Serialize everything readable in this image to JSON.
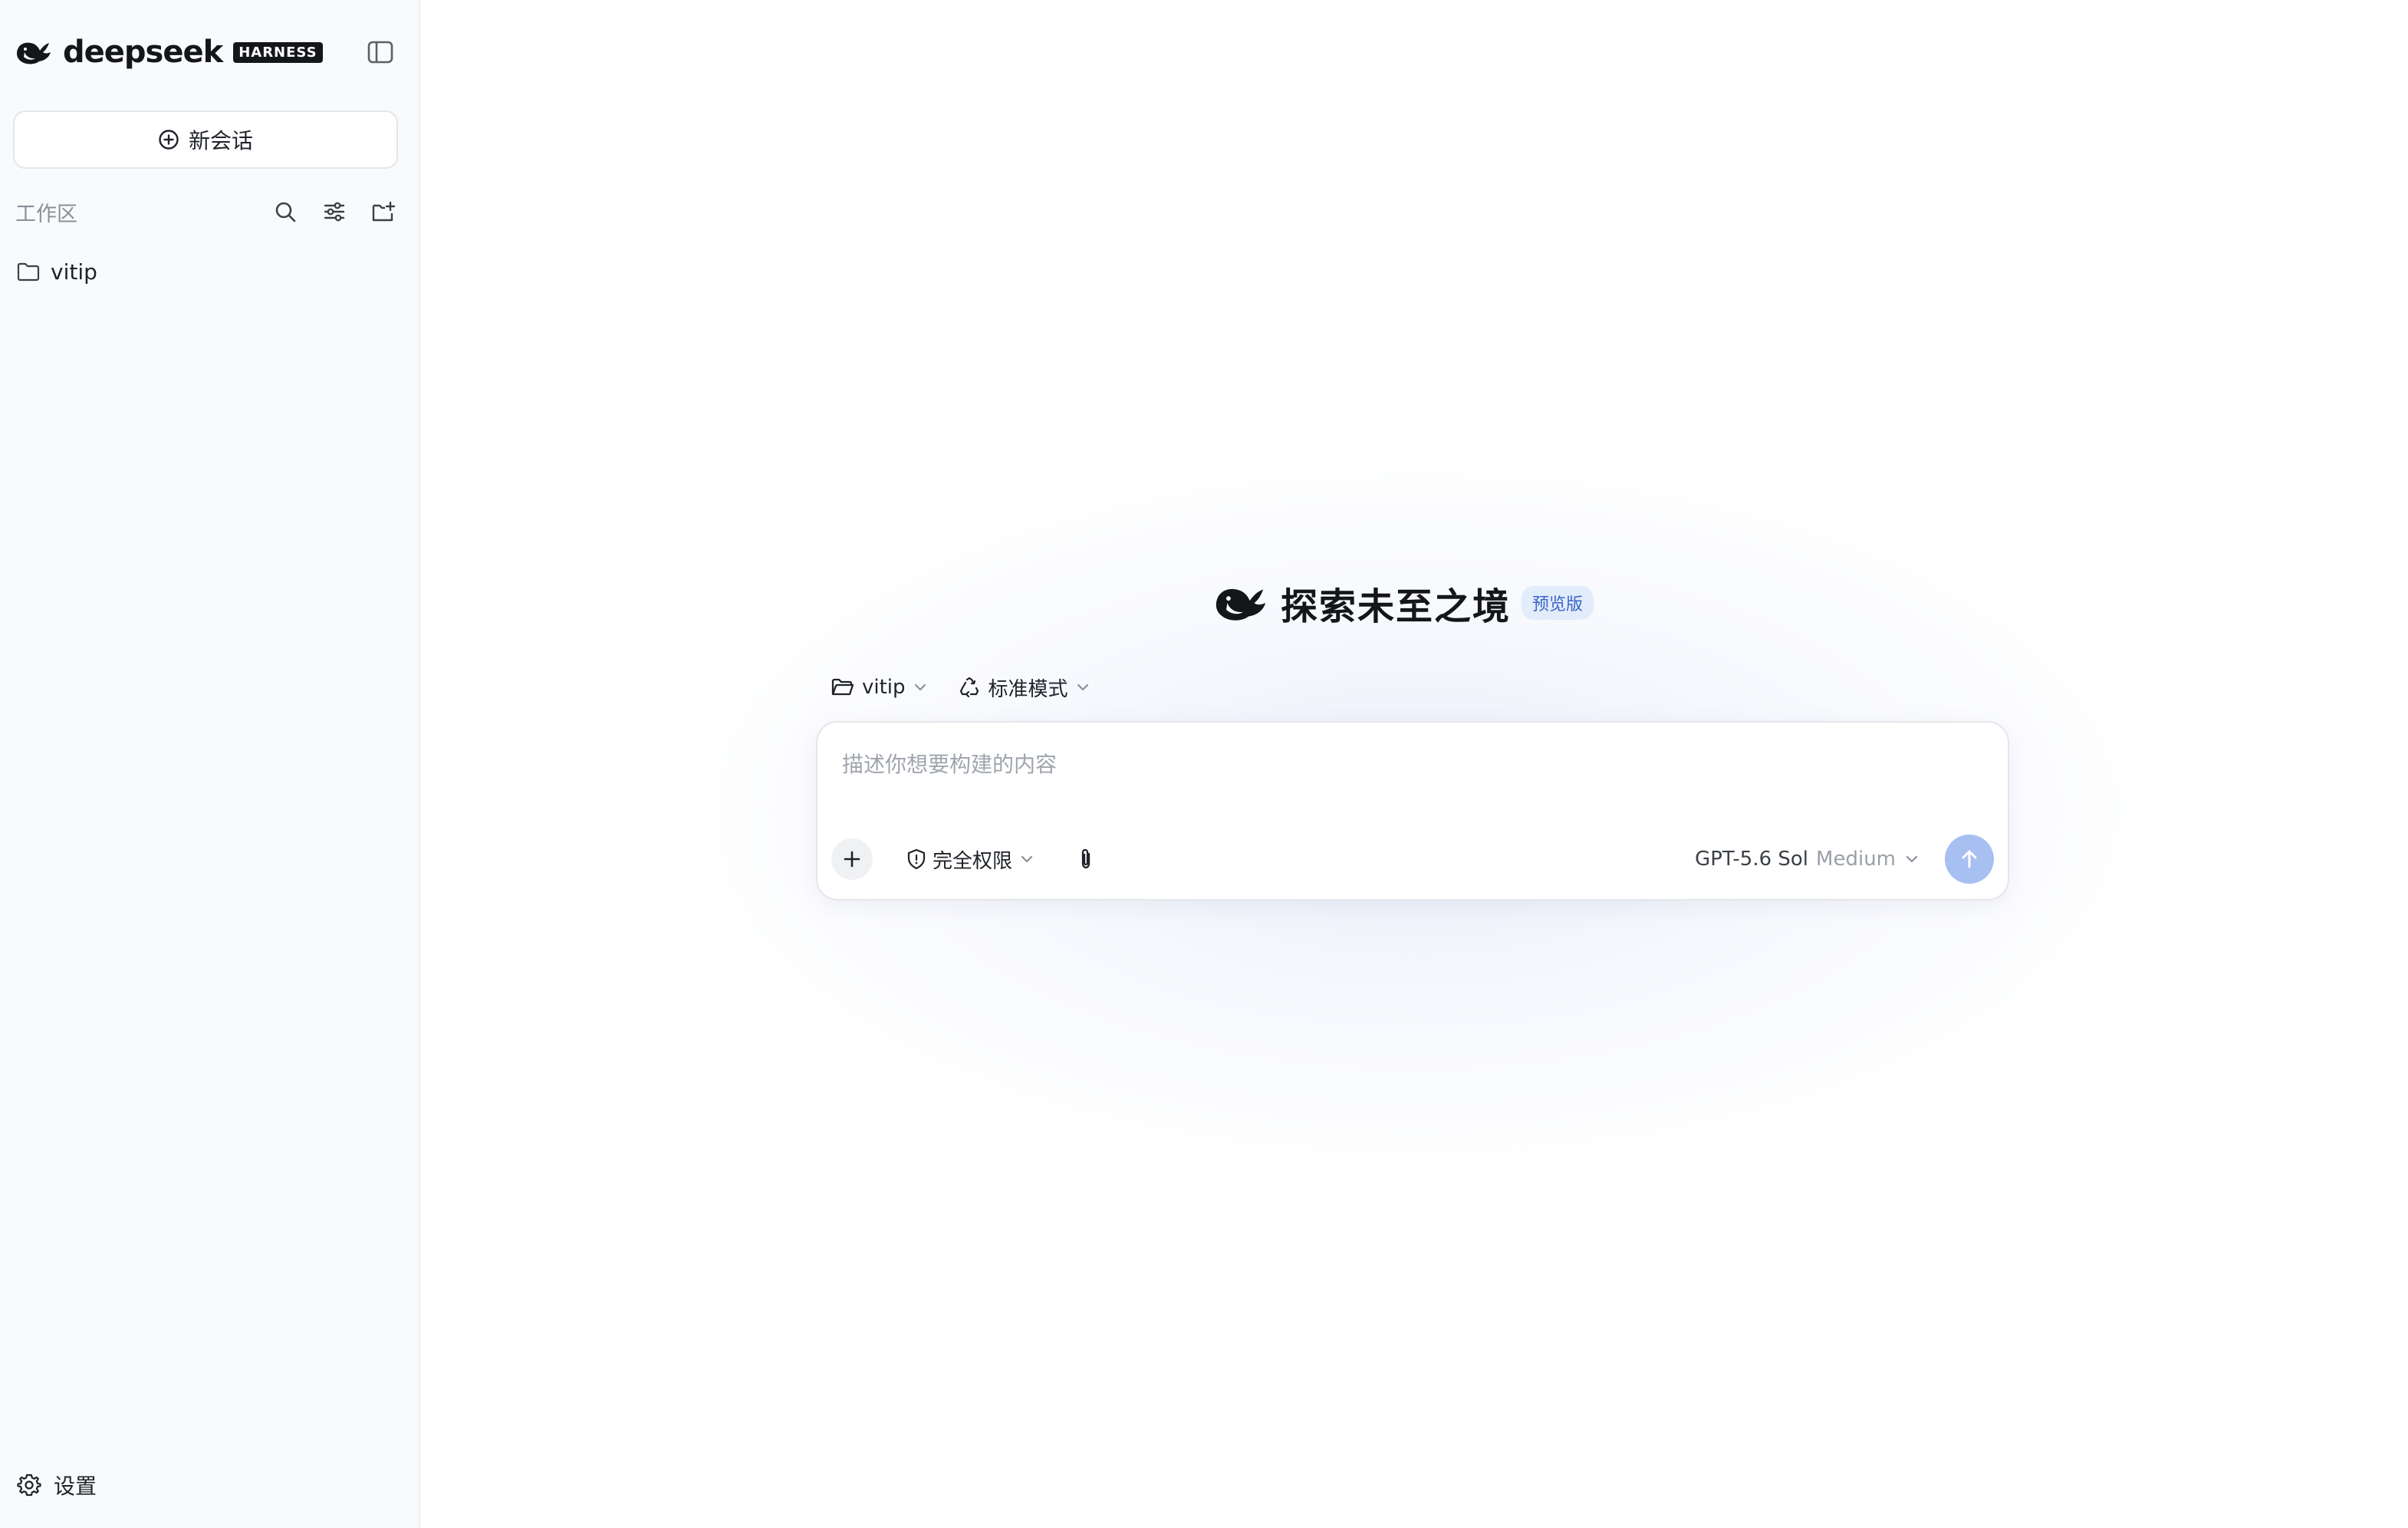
{
  "brand": {
    "name": "deepseek",
    "tag": "HARNESS",
    "logo_icon": "whale-icon"
  },
  "sidebar": {
    "new_chat_label": "新会话",
    "workspace_title": "工作区",
    "workspace_items": [
      {
        "label": "vitip",
        "icon": "folder-icon"
      }
    ],
    "settings_label": "设置"
  },
  "main": {
    "hero_title": "探索未至之境",
    "hero_badge": "预览版",
    "context": {
      "folder_label": "vitip",
      "mode_label": "标准模式"
    },
    "composer": {
      "placeholder": "描述你想要构建的内容",
      "value": "",
      "permission_label": "完全权限",
      "model_name": "GPT-5.6 Sol",
      "model_level": "Medium"
    }
  },
  "colors": {
    "accent": "#a8bff2",
    "badge_bg": "#e3ecfb",
    "badge_text": "#3a64c8",
    "sidebar_bg": "#f9fafb"
  }
}
